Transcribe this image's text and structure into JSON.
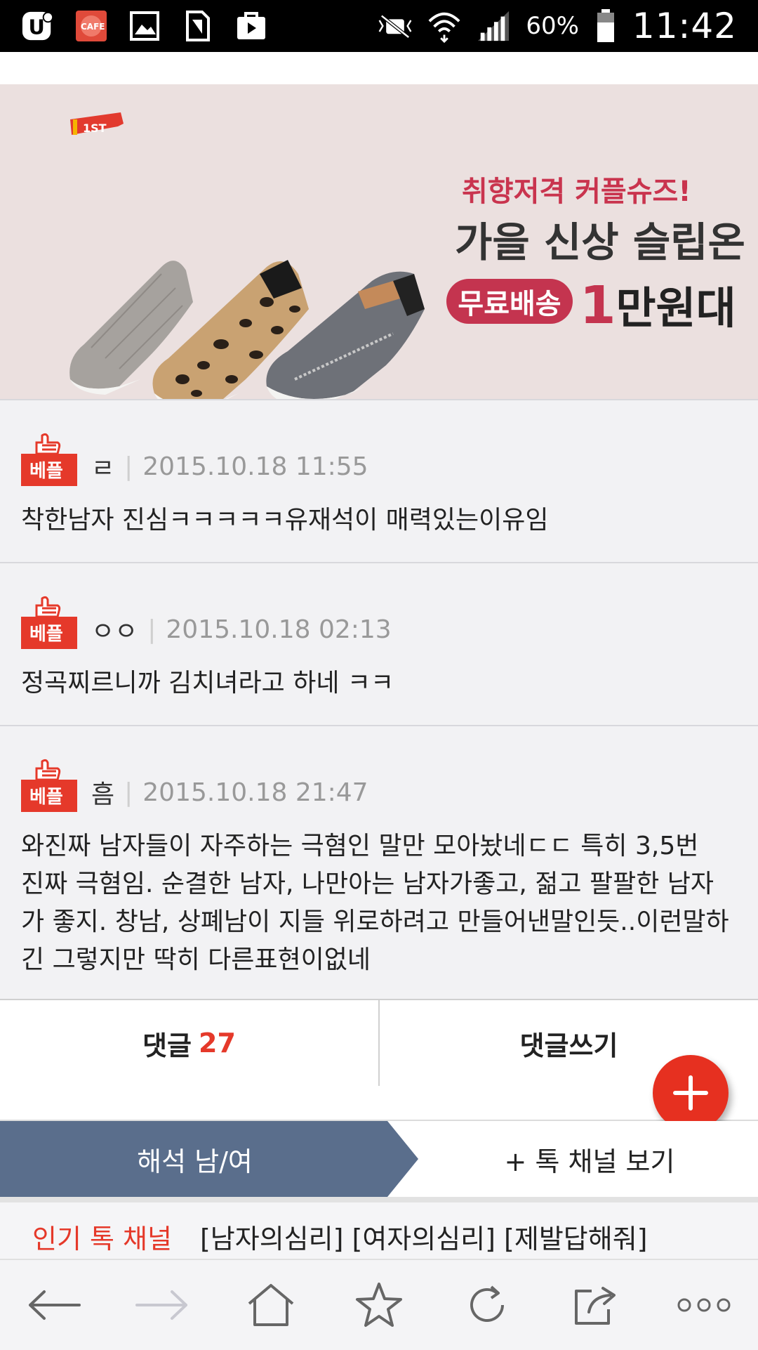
{
  "status_bar": {
    "battery": "60%",
    "time": "11:42",
    "icons": [
      "u-app-icon",
      "cafe-icon",
      "gallery-icon",
      "sim-icon",
      "store-icon",
      "mute-icon",
      "wifi-icon",
      "signal-icon",
      "battery-icon"
    ],
    "cafe_label": "CAFE"
  },
  "banner": {
    "logo_text": "1ST",
    "line1": "취향저격 커플슈즈!",
    "line2": "가을 신상 슬립온",
    "badge": "무료배송",
    "price_num": "1",
    "price_text": "만원대"
  },
  "comments": [
    {
      "badge": "베플",
      "author": "ㄹ",
      "date": "2015.10.18 11:55",
      "text": "착한남자 진심ㅋㅋㅋㅋㅋ유재석이 매력있는이유임"
    },
    {
      "badge": "베플",
      "author": "ㅇㅇ",
      "date": "2015.10.18 02:13",
      "text": "정곡찌르니까 김치녀라고 하네 ㅋㅋ"
    },
    {
      "badge": "베플",
      "author": "흠",
      "date": "2015.10.18 21:47",
      "text_lines": [
        "와진짜 남자들이 자주하는 극혐인 말만 모아놨네ㄷㄷ 특히 3,5번",
        "진짜 극혐임. 순결한 남자, 나만아는 남자가좋고, 젊고 팔팔한 남자",
        "가 좋지. 창남, 상폐남이 지들 위로하려고 만들어낸말인듯..이런말하",
        "긴 그렇지만 딱히 다른표현이없네"
      ]
    }
  ],
  "actions": {
    "comments_label": "댓글",
    "comments_count": "27",
    "write_label": "댓글쓰기"
  },
  "channel": {
    "active_tab": "해석 남/여",
    "more_tab": "+ 톡 채널 보기"
  },
  "popular": {
    "title": "인기 톡 채널",
    "tags": "[남자의심리] [여자의심리] [제발답해줘]"
  },
  "colors": {
    "accent": "#e5392a",
    "banner_bg": "#ebe0df",
    "tab_active": "#5a6e8c",
    "banner_pink": "#c4344f"
  }
}
